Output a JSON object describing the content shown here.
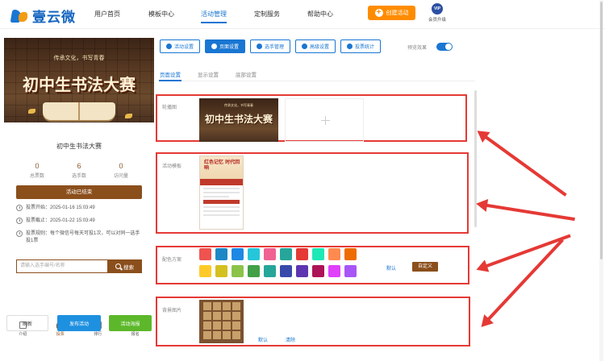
{
  "brand": {
    "name": "壹云微"
  },
  "nav": {
    "items": [
      {
        "label": "用户首页"
      },
      {
        "label": "模板中心"
      },
      {
        "label": "活动管理"
      },
      {
        "label": "定制服务"
      },
      {
        "label": "帮助中心"
      }
    ],
    "active_index": 2,
    "create_button": "创建活动",
    "vip_badge": "VIP",
    "vip_label": "会员升级"
  },
  "preview": {
    "hero_subtitle": "传承文化，书写青春",
    "hero_title": "初中生书法大赛",
    "event_title": "初中生书法大赛",
    "stats": [
      {
        "value": "0",
        "label": "总票数"
      },
      {
        "value": "6",
        "label": "选手数"
      },
      {
        "value": "0",
        "label": "访问量"
      }
    ],
    "status_bar": "活动已结束",
    "vote_start": "投票开始：2025-01-16 15:03:49",
    "vote_end": "投票截止：2025-01-22 15:03:49",
    "vote_rule": "投票规则：每个微信号每天可投1次，可以对同一选手投1票",
    "search_placeholder": "请输入选手编号/名称",
    "search_button": "搜索",
    "tabs": [
      {
        "label": "介绍",
        "icon": "calendar-icon"
      },
      {
        "label": "投票",
        "icon": "user-icon"
      },
      {
        "label": "排行",
        "icon": "ranking-icon"
      },
      {
        "label": "报名",
        "icon": "signup-icon"
      }
    ],
    "active_tab": 1
  },
  "actions": {
    "refresh": "刷新",
    "publish": "发布活动",
    "gift": "活动海报"
  },
  "editor": {
    "toolbar": [
      {
        "label": "活动设置",
        "icon": "settings-icon"
      },
      {
        "label": "页面设置",
        "icon": "page-icon"
      },
      {
        "label": "选手管理",
        "icon": "users-icon"
      },
      {
        "label": "高级设置",
        "icon": "advanced-icon"
      },
      {
        "label": "投票统计",
        "icon": "chart-icon"
      }
    ],
    "active_toolbar": 1,
    "preview_toggle_label": "预览效果",
    "preview_toggle_on": true,
    "subtabs": [
      {
        "label": "页面设置"
      },
      {
        "label": "显示设置"
      },
      {
        "label": "底部设置"
      }
    ],
    "active_subtab": 0,
    "carousel": {
      "label": "轮播图",
      "image_subtitle": "传承文化，书写青春",
      "image_title": "初中生书法大赛"
    },
    "template": {
      "label": "活动模板",
      "thumb_title": "红色记忆 时代回响"
    },
    "colors": {
      "label": "配色方案",
      "row1": [
        "#ef5350",
        "#1e88c7",
        "#1e88e5",
        "#26c6da",
        "#f06292",
        "#26a69a",
        "#e53935",
        "#1de9b6",
        "#ff8a50",
        "#ef6c00"
      ],
      "row2": [
        "#ffca28",
        "#d4c020",
        "#8bc34a",
        "#43a047",
        "#26a69a",
        "#3949ab",
        "#5e35b1",
        "#ad1457",
        "#e040fb",
        "#a855f7"
      ],
      "default_link": "默认",
      "custom_button": "自定义"
    },
    "background": {
      "label": "背景图片",
      "default_link": "默认",
      "clear_link": "清除"
    }
  }
}
